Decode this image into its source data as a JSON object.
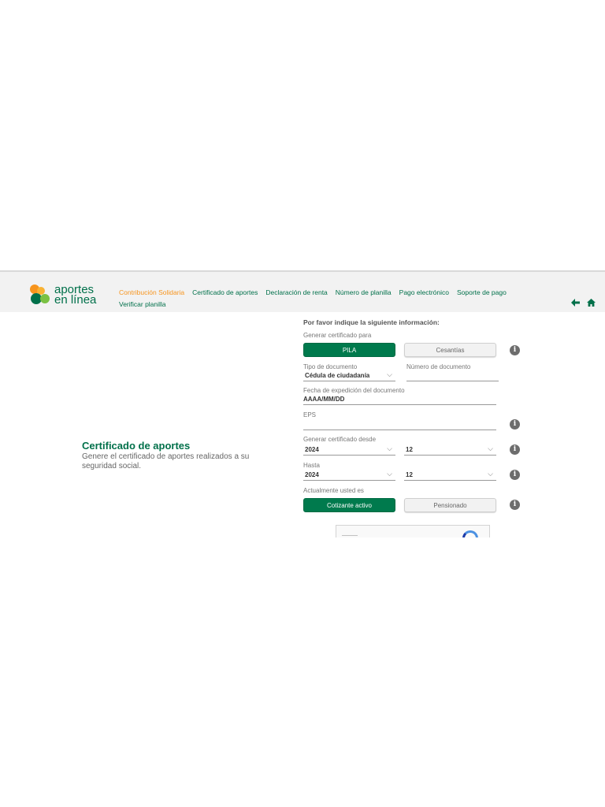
{
  "header": {
    "logo_line1": "aportes",
    "logo_line2": "en línea",
    "nav": [
      {
        "label": "Contribución Solidaria",
        "active": true
      },
      {
        "label": "Certificado de aportes",
        "active": false
      },
      {
        "label": "Declaración de renta",
        "active": false
      },
      {
        "label": "Número de planilla",
        "active": false
      },
      {
        "label": "Pago electrónico",
        "active": false
      },
      {
        "label": "Soporte de pago",
        "active": false
      },
      {
        "label": "Verificar planilla",
        "active": false
      }
    ],
    "icons": [
      "back-arrow-icon",
      "home-icon"
    ]
  },
  "intro": {
    "title": "Certificado de aportes",
    "description": "Genere el certificado de aportes realizados a su seguridad social."
  },
  "form": {
    "heading": "Por favor indique la siguiente información:",
    "generate_for_label": "Generar certificado para",
    "generate_for_options": [
      "PILA",
      "Cesantías"
    ],
    "generate_for_selected": "PILA",
    "doc_type_label": "Tipo de documento",
    "doc_type_value": "Cédula de ciudadanía",
    "doc_number_label": "Número de documento",
    "doc_number_value": "",
    "expedition_label": "Fecha de expedición del documento",
    "expedition_value": "AAAA/MM/DD",
    "eps_label": "EPS",
    "eps_value": "",
    "from_label": "Generar certificado desde",
    "from_year": "2024",
    "from_month": "12",
    "to_label": "Hasta",
    "to_year": "2024",
    "to_month": "12",
    "status_label": "Actualmente usted es",
    "status_options": [
      "Cotizante activo",
      "Pensionado"
    ],
    "status_selected": "Cotizante activo",
    "info_glyph": "i",
    "chevron_glyph": "⌵"
  },
  "colors": {
    "brand_green": "#007a4d",
    "accent_orange": "#f7941d",
    "header_bg": "#f2f2f2"
  }
}
